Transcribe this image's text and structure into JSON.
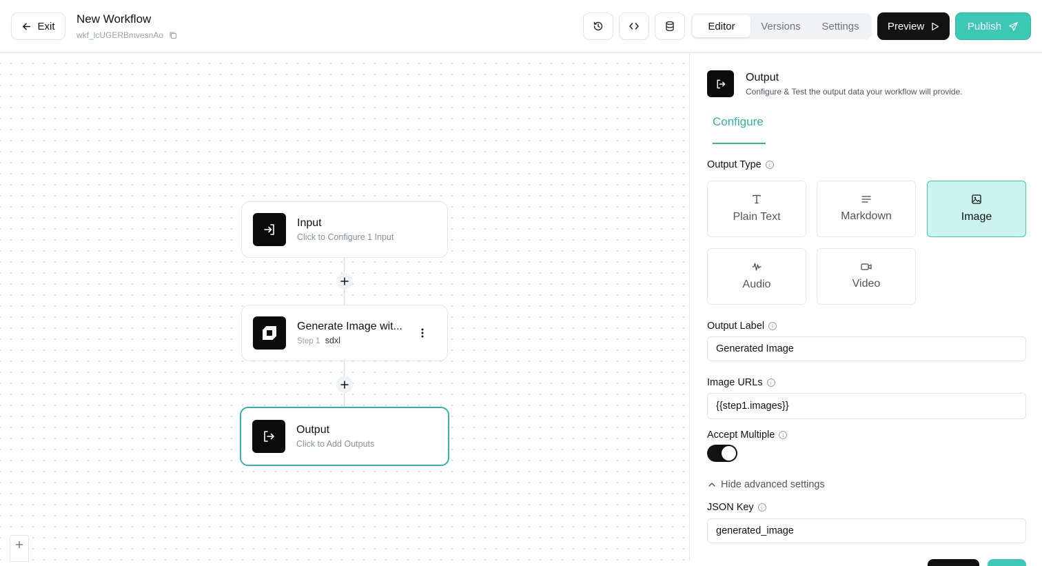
{
  "header": {
    "exit_label": "Exit",
    "workflow_title": "New Workflow",
    "workflow_id": "wkf_lcUGERBmvesnAo",
    "tabs": [
      {
        "label": "Editor",
        "active": true
      },
      {
        "label": "Versions",
        "active": false
      },
      {
        "label": "Settings",
        "active": false
      }
    ],
    "preview_label": "Preview",
    "publish_label": "Publish",
    "icons": [
      "history-icon",
      "code-icon",
      "database-icon"
    ]
  },
  "canvas": {
    "nodes": [
      {
        "title": "Input",
        "subtitle": "Click to Configure 1 Input",
        "icon": "input-icon"
      },
      {
        "title": "Generate Image wit...",
        "step": "Step 1",
        "model": "sdxl",
        "icon": "generate-image-icon"
      },
      {
        "title": "Output",
        "subtitle": "Click to Add Outputs",
        "icon": "output-icon",
        "selected": true
      }
    ]
  },
  "panel": {
    "title": "Output",
    "description": "Configure & Test the output data your workflow will provide.",
    "tab": "Configure",
    "output_type_label": "Output Type",
    "output_types": [
      {
        "label": "Plain Text",
        "icon": "text-icon",
        "active": false
      },
      {
        "label": "Markdown",
        "icon": "markdown-icon",
        "active": false
      },
      {
        "label": "Image",
        "icon": "image-icon",
        "active": true
      },
      {
        "label": "Audio",
        "icon": "audio-icon",
        "active": false
      },
      {
        "label": "Video",
        "icon": "video-icon",
        "active": false
      }
    ],
    "output_label_label": "Output Label",
    "output_label_value": "Generated Image",
    "image_urls_label": "Image URLs",
    "image_urls_value": "{{step1.images}}",
    "accept_multiple_label": "Accept Multiple",
    "accept_multiple_on": true,
    "advanced_toggle_label": "Hide advanced settings",
    "json_key_label": "JSON Key",
    "json_key_value": "generated_image"
  },
  "colors": {
    "accent": "#3cc8b4",
    "accent_dark": "#2fb5a2",
    "accent_light": "#ccf4ee",
    "dark": "#121212"
  }
}
